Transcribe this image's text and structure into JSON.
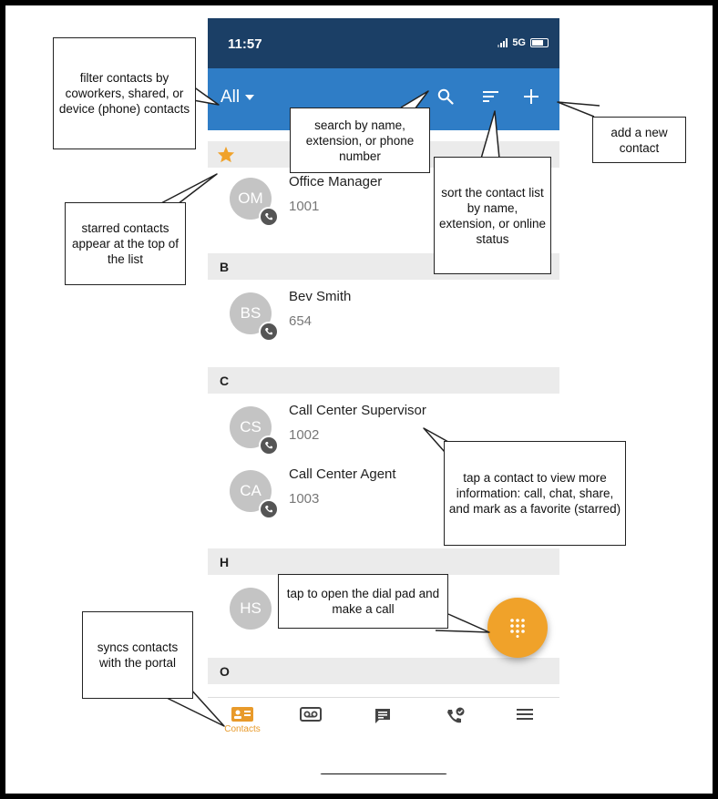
{
  "status_bar": {
    "time": "11:57",
    "network": "5G"
  },
  "app_bar": {
    "filter_label": "All"
  },
  "contacts": {
    "sections": [
      {
        "header": "",
        "starred": true,
        "items": [
          {
            "initials": "OM",
            "name": "Office Manager",
            "ext": "1001"
          }
        ]
      },
      {
        "header": "B",
        "items": [
          {
            "initials": "BS",
            "name": "Bev Smith",
            "ext": "654"
          }
        ]
      },
      {
        "header": "C",
        "items": [
          {
            "initials": "CS",
            "name": "Call Center Supervisor",
            "ext": "1002"
          },
          {
            "initials": "CA",
            "name": "Call Center Agent",
            "ext": "1003"
          }
        ]
      },
      {
        "header": "H",
        "items": [
          {
            "initials": "HS",
            "name": "",
            "ext": ""
          }
        ]
      },
      {
        "header": "O",
        "items": []
      }
    ]
  },
  "tabs": {
    "contacts_label": "Contacts"
  },
  "callouts": {
    "filter": "filter contacts by coworkers, shared, or device (phone) contacts",
    "search": "search by name, extension, or phone number",
    "add": "add a new contact",
    "sort": "sort the contact list by name, extension, or online status",
    "starred": "starred contacts appear at the top of the list",
    "tap_contact": "tap a contact to view more information: call, chat, share, and mark as a favorite (starred)",
    "dialpad": "tap to open the dial pad and make a call",
    "sync": "syncs contacts with the portal"
  },
  "colors": {
    "appbar": "#2f7dc6",
    "statusbar": "#1b3f66",
    "accent": "#f0a22a",
    "section_bg": "#ebebeb",
    "avatar": "#c4c4c4"
  },
  "icons": [
    "search-icon",
    "sort-icon",
    "add-icon",
    "star-icon",
    "phone-badge-icon",
    "dialpad-icon",
    "contacts-tab-icon",
    "voicemail-tab-icon",
    "chat-tab-icon",
    "calls-tab-icon",
    "menu-tab-icon"
  ]
}
